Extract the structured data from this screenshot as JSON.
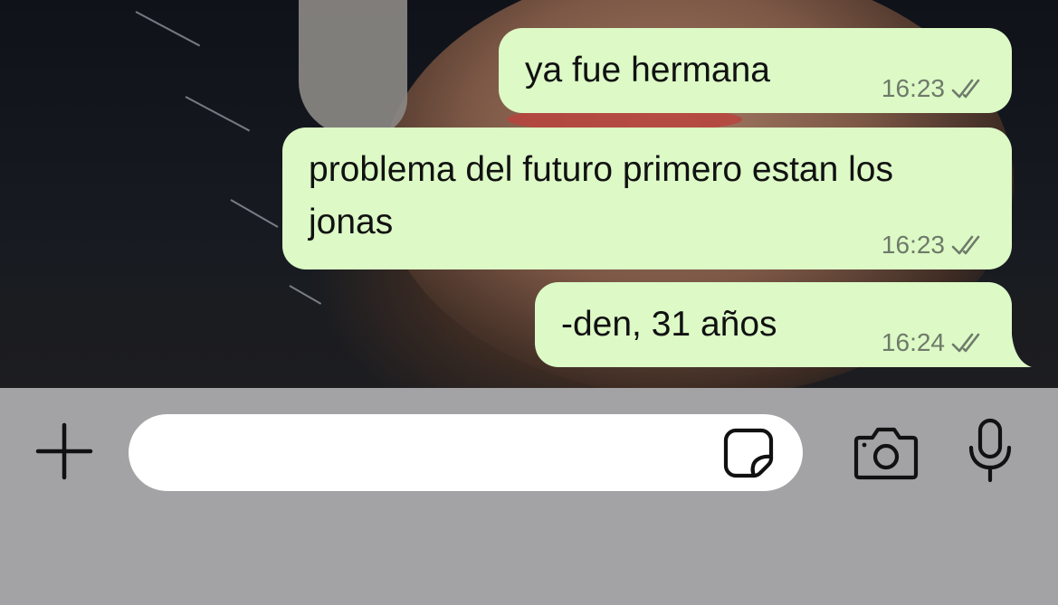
{
  "chat": {
    "messages": [
      {
        "text": "ya fue hermana",
        "time": "16:23",
        "status": "read-double-check"
      },
      {
        "text": "problema del futuro primero estan los jonas",
        "time": "16:23",
        "status": "read-double-check"
      },
      {
        "text": "-den, 31 años",
        "time": "16:24",
        "status": "read-double-check"
      }
    ],
    "bubble_color": "#dcf9c6"
  },
  "input_bar": {
    "plus_icon": "plus-icon",
    "message_field": {
      "value": "",
      "placeholder": ""
    },
    "sticker_icon": "sticker-icon",
    "camera_icon": "camera-icon",
    "mic_icon": "microphone-icon"
  }
}
